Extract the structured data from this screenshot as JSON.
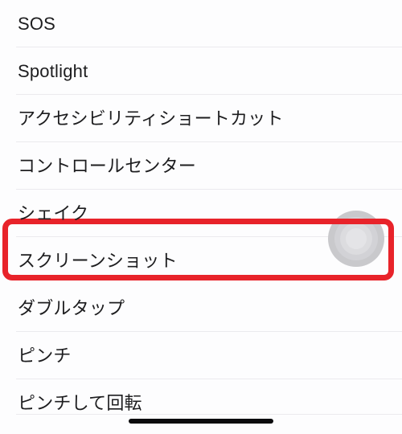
{
  "screen": {
    "title": "Accessibility gestures list",
    "background_color": "#fdfdfe",
    "text_color": "#1d1d1f",
    "separator_color": "#ebeaee"
  },
  "list": {
    "rows": [
      {
        "label": "SOS"
      },
      {
        "label": "Spotlight"
      },
      {
        "label": "アクセシビリティショートカット"
      },
      {
        "label": "コントロールセンター"
      },
      {
        "label": "シェイク"
      },
      {
        "label": "スクリーンショット"
      },
      {
        "label": "ダブルタップ"
      },
      {
        "label": "ピンチ"
      },
      {
        "label": "ピンチして回転"
      }
    ]
  },
  "annotation": {
    "highlight_color": "#e8232a",
    "highlighted_row_label": "スクリーンショット"
  },
  "touch_indicator": {
    "name": "assistive-touch-circle",
    "color": "#c9c9cc"
  },
  "home_indicator": {
    "color": "#0b0b0d"
  }
}
